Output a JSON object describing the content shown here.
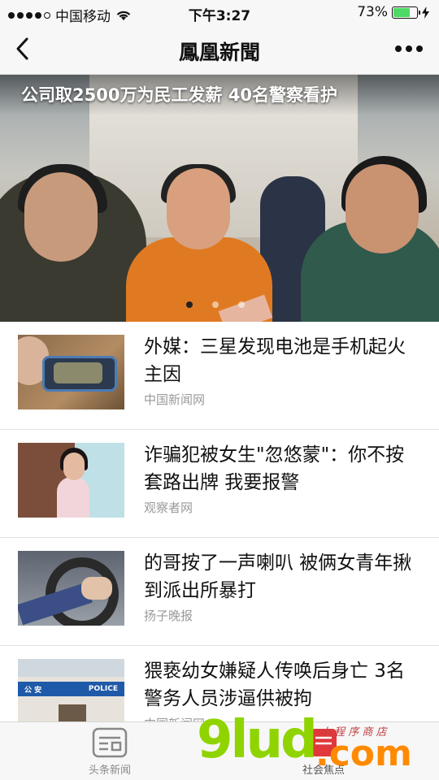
{
  "status_bar": {
    "carrier": "中国移动",
    "time": "下午3:27",
    "battery": "73%",
    "signal_level": 4,
    "battery_level": 0.73
  },
  "nav": {
    "title": "鳳凰新聞",
    "back_icon": "chevron-left-icon",
    "more_icon": "more-dots-icon"
  },
  "banner": {
    "headline": "公司取2500万为民工发薪 40名警察看护",
    "slide_count": 3,
    "active_slide": 1
  },
  "news": [
    {
      "title": "外媒：三星发现电池是手机起火主因",
      "source": "中国新闻网",
      "thumb": "burnt-phone-photo"
    },
    {
      "title": "诈骗犯被女生\"忽悠蒙\"：你不按套路出牌 我要报警",
      "source": "观察者网",
      "thumb": "girl-on-phone-photo"
    },
    {
      "title": "的哥按了一声喇叭 被俩女青年揪到派出所暴打",
      "source": "扬子晚报",
      "thumb": "steering-wheel-photo"
    },
    {
      "title": "猥亵幼女嫌疑人传唤后身亡 3名警务人员涉逼供被拘",
      "source": "中国新闻网",
      "thumb": "police-station-photo"
    }
  ],
  "thumb_text": {
    "police_cn": "公 安",
    "police_en": "POLICE"
  },
  "tabs": [
    {
      "label": "头条新闻",
      "icon": "newspaper-icon",
      "active": false
    },
    {
      "label": "社会焦点",
      "icon": "focus-icon",
      "active": true
    }
  ],
  "watermark": {
    "brand": "9lud",
    "suffix": ".com",
    "script": "小 程 序 商 店"
  },
  "colors": {
    "bar_background": "#f7f7f7",
    "battery_green": "#4cd964",
    "source_gray": "#9a9a9a",
    "tab_active_red": "#e0383b"
  }
}
